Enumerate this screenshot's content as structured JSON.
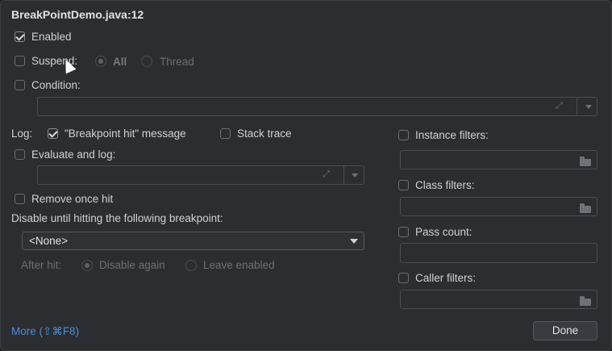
{
  "title": "BreakPointDemo.java:12",
  "enabled": {
    "label": "Enabled",
    "checked": true
  },
  "suspend": {
    "label": "Suspend:",
    "checked": false,
    "options": [
      "All",
      "Thread"
    ],
    "selected": "All"
  },
  "condition": {
    "label": "Condition:",
    "checked": false,
    "value": ""
  },
  "log": {
    "label": "Log:",
    "breakpoint_hit": {
      "label": "\"Breakpoint hit\" message",
      "checked": true
    },
    "stack_trace": {
      "label": "Stack trace",
      "checked": false
    }
  },
  "evaluate": {
    "label": "Evaluate and log:",
    "checked": false,
    "value": ""
  },
  "remove_once_hit": {
    "label": "Remove once hit",
    "checked": false
  },
  "disable_until": {
    "label": "Disable until hitting the following breakpoint:",
    "selected": "<None>"
  },
  "after_hit": {
    "label": "After hit:",
    "options": [
      "Disable again",
      "Leave enabled"
    ],
    "selected": "Disable again"
  },
  "filters": {
    "instance": {
      "label": "Instance filters:",
      "checked": false
    },
    "class": {
      "label": "Class filters:",
      "checked": false
    },
    "pass_count": {
      "label": "Pass count:",
      "checked": false
    },
    "caller": {
      "label": "Caller filters:",
      "checked": false
    }
  },
  "footer": {
    "more": "More (⇧⌘F8)",
    "done": "Done"
  },
  "icons": [
    "checkbox-icon",
    "radio-icon",
    "expand-icon",
    "dropdown-arrow-icon",
    "folder-icon",
    "mouse-cursor-icon"
  ]
}
